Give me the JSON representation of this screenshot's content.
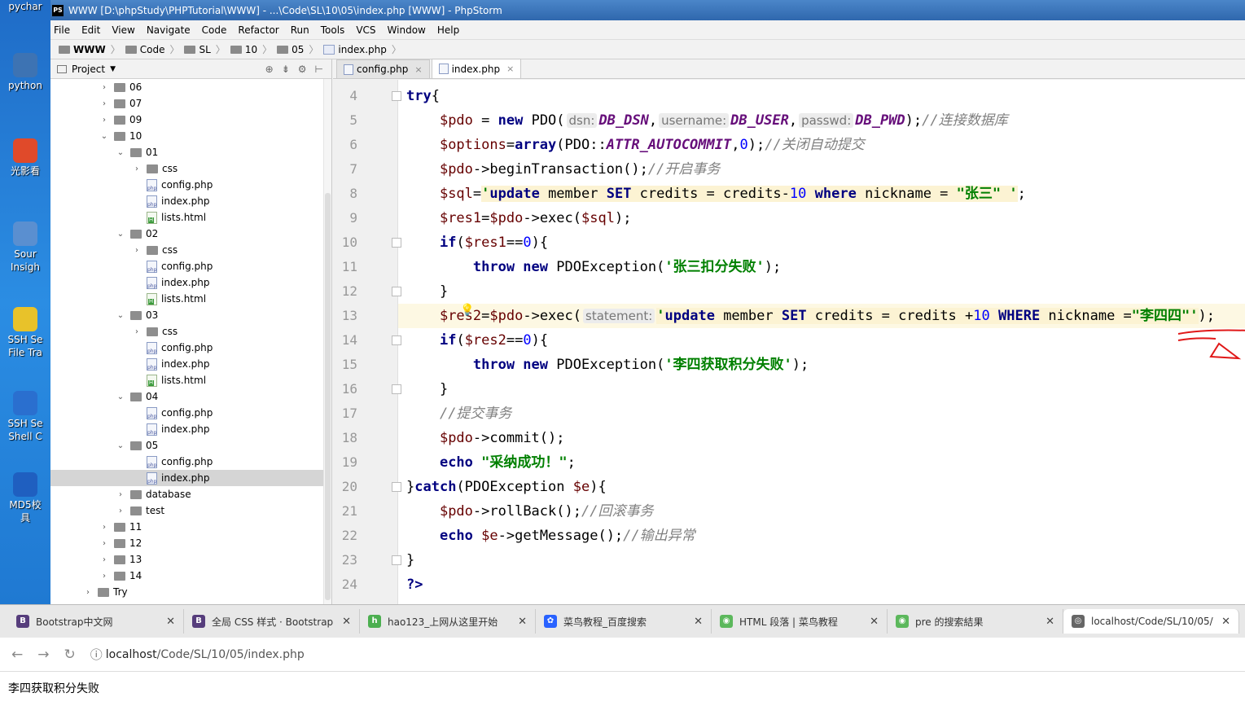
{
  "desktop": {
    "icons": [
      {
        "label": "pychar",
        "color": "#3a9b6b"
      },
      {
        "label": "python",
        "color": "#3d73b3"
      },
      {
        "label": "光影看",
        "color": "#e04a2a"
      },
      {
        "label": "Sour\nInsigh",
        "color": "#5a8fd0"
      },
      {
        "label": "SSH Se\nFile Tra",
        "color": "#e8c22a"
      },
      {
        "label": "SSH Se\nShell C",
        "color": "#2a6fcf"
      },
      {
        "label": "MD5校\n具",
        "color": "#1f5fc0"
      }
    ]
  },
  "ide": {
    "window_title": "WWW [D:\\phpStudy\\PHPTutorial\\WWW] - ...\\Code\\SL\\10\\05\\index.php [WWW] - PhpStorm",
    "app_icon": "PS",
    "menu": [
      "File",
      "Edit",
      "View",
      "Navigate",
      "Code",
      "Refactor",
      "Run",
      "Tools",
      "VCS",
      "Window",
      "Help"
    ],
    "breadcrumbs": [
      "WWW",
      "Code",
      "SL",
      "10",
      "05",
      "index.php"
    ],
    "project_panel_title": "Project",
    "tree": [
      {
        "label": "06",
        "type": "folder",
        "depth": 0,
        "arrow": "›"
      },
      {
        "label": "07",
        "type": "folder",
        "depth": 0,
        "arrow": "›"
      },
      {
        "label": "09",
        "type": "folder",
        "depth": 0,
        "arrow": "›"
      },
      {
        "label": "10",
        "type": "folder",
        "depth": 0,
        "arrow": "⌄"
      },
      {
        "label": "01",
        "type": "folder",
        "depth": 1,
        "arrow": "⌄"
      },
      {
        "label": "css",
        "type": "folder",
        "depth": 2,
        "arrow": "›"
      },
      {
        "label": "config.php",
        "type": "php",
        "depth": 2,
        "arrow": ""
      },
      {
        "label": "index.php",
        "type": "php",
        "depth": 2,
        "arrow": ""
      },
      {
        "label": "lists.html",
        "type": "html",
        "depth": 2,
        "arrow": ""
      },
      {
        "label": "02",
        "type": "folder",
        "depth": 1,
        "arrow": "⌄"
      },
      {
        "label": "css",
        "type": "folder",
        "depth": 2,
        "arrow": "›"
      },
      {
        "label": "config.php",
        "type": "php",
        "depth": 2,
        "arrow": ""
      },
      {
        "label": "index.php",
        "type": "php",
        "depth": 2,
        "arrow": ""
      },
      {
        "label": "lists.html",
        "type": "html",
        "depth": 2,
        "arrow": ""
      },
      {
        "label": "03",
        "type": "folder",
        "depth": 1,
        "arrow": "⌄"
      },
      {
        "label": "css",
        "type": "folder",
        "depth": 2,
        "arrow": "›"
      },
      {
        "label": "config.php",
        "type": "php",
        "depth": 2,
        "arrow": ""
      },
      {
        "label": "index.php",
        "type": "php",
        "depth": 2,
        "arrow": ""
      },
      {
        "label": "lists.html",
        "type": "html",
        "depth": 2,
        "arrow": ""
      },
      {
        "label": "04",
        "type": "folder",
        "depth": 1,
        "arrow": "⌄"
      },
      {
        "label": "config.php",
        "type": "php",
        "depth": 2,
        "arrow": ""
      },
      {
        "label": "index.php",
        "type": "php",
        "depth": 2,
        "arrow": ""
      },
      {
        "label": "05",
        "type": "folder",
        "depth": 1,
        "arrow": "⌄"
      },
      {
        "label": "config.php",
        "type": "php",
        "depth": 2,
        "arrow": ""
      },
      {
        "label": "index.php",
        "type": "php",
        "depth": 2,
        "arrow": "",
        "selected": true
      },
      {
        "label": "database",
        "type": "folder",
        "depth": 1,
        "arrow": "›"
      },
      {
        "label": "test",
        "type": "folder",
        "depth": 1,
        "arrow": "›"
      },
      {
        "label": "11",
        "type": "folder",
        "depth": 0,
        "arrow": "›"
      },
      {
        "label": "12",
        "type": "folder",
        "depth": 0,
        "arrow": "›"
      },
      {
        "label": "13",
        "type": "folder",
        "depth": 0,
        "arrow": "›"
      },
      {
        "label": "14",
        "type": "folder",
        "depth": 0,
        "arrow": "›"
      },
      {
        "label": "Try",
        "type": "folder",
        "depth": -1,
        "arrow": "›"
      }
    ],
    "editor_tabs": [
      {
        "label": "config.php",
        "active": false
      },
      {
        "label": "index.php",
        "active": true
      }
    ],
    "code_lines": [
      {
        "n": "4",
        "html": "<span class=\"kw\">try</span>{"
      },
      {
        "n": "5",
        "html": "    <span class=\"var\">$pdo</span> = <span class=\"kw\">new</span> PDO(<span class=\"hint\">dsn:</span><span class=\"cn\">DB_DSN</span>,<span class=\"hint\">username:</span><span class=\"cn\">DB_USER</span>,<span class=\"hint\">passwd:</span><span class=\"cn\">DB_PWD</span>);<span class=\"cm\">//连接数据库</span>"
      },
      {
        "n": "6",
        "html": "    <span class=\"var\">$options</span>=<span class=\"kw\">array</span>(PDO::<span class=\"cn\">ATTR_AUTOCOMMIT</span>,<span class=\"num\">0</span>);<span class=\"cm\">//关闭自动提交</span>"
      },
      {
        "n": "7",
        "html": "    <span class=\"var\">$pdo</span>-&gt;beginTransaction();<span class=\"cm\">//开启事务</span>"
      },
      {
        "n": "8",
        "html": "    <span class=\"var\">$sql</span>=<span class=\"sqlbg\"><span class=\"st\">'</span><span class=\"kw\">update</span> member <span class=\"kw\">SET</span> credits = credits-<span class=\"num\">10</span> <span class=\"kw\">where</span> nickname = <span class=\"st\">\"张三\"</span> <span class=\"st\">'</span></span>;"
      },
      {
        "n": "9",
        "html": "    <span class=\"var\">$res1</span>=<span class=\"var\">$pdo</span>-&gt;exec(<span class=\"var\">$sql</span>);"
      },
      {
        "n": "10",
        "html": "    <span class=\"kw\">if</span>(<span class=\"var\">$res1</span>==<span class=\"num\">0</span>){"
      },
      {
        "n": "11",
        "html": "        <span class=\"kw\">throw new</span> PDOException(<span class=\"st\">'张三扣分失败'</span>);"
      },
      {
        "n": "12",
        "html": "    }"
      },
      {
        "n": "13",
        "html": "    <span class=\"var\">$res2</span>=<span class=\"var\">$pdo</span>-&gt;exec(<span class=\"hint\">statement:</span><span class=\"sqlbg\"><span class=\"st\">'</span><span class=\"kw\">update</span> member <span class=\"kw\">SET</span> credits = credits +<span class=\"num\">10</span> <span class=\"kw\">WHERE</span> nickname =<span class=\"st\">\"李四四\"</span><span class=\"st\">'</span></span>);",
        "highlight": true
      },
      {
        "n": "14",
        "html": "    <span class=\"kw\">if</span>(<span class=\"var\">$res2</span>==<span class=\"num\">0</span>){"
      },
      {
        "n": "15",
        "html": "        <span class=\"kw\">throw new</span> PDOException(<span class=\"st\">'李四获取积分失败'</span>);"
      },
      {
        "n": "16",
        "html": "    }"
      },
      {
        "n": "17",
        "html": "    <span class=\"cm\">//提交事务</span>"
      },
      {
        "n": "18",
        "html": "    <span class=\"var\">$pdo</span>-&gt;commit();"
      },
      {
        "n": "19",
        "html": "    <span class=\"kw\">echo</span> <span class=\"st\">\"采纳成功！\"</span>;"
      },
      {
        "n": "20",
        "html": "}<span class=\"kw\">catch</span>(PDOException <span class=\"var\">$e</span>){"
      },
      {
        "n": "21",
        "html": "    <span class=\"var\">$pdo</span>-&gt;rollBack();<span class=\"cm\">//回滚事务</span>"
      },
      {
        "n": "22",
        "html": "    <span class=\"kw\">echo</span> <span class=\"var\">$e</span>-&gt;getMessage();<span class=\"cm\">//输出异常</span>"
      },
      {
        "n": "23",
        "html": "}"
      },
      {
        "n": "24",
        "html": "<span class=\"kw\">?&gt;</span>"
      }
    ]
  },
  "browser": {
    "tabs": [
      {
        "label": "Bootstrap中文网",
        "icon": "B",
        "color": "#563d7c"
      },
      {
        "label": "全局 CSS 样式 · Bootstrap v",
        "icon": "B",
        "color": "#563d7c"
      },
      {
        "label": "hao123_上网从这里开始",
        "icon": "h",
        "color": "#4caf50"
      },
      {
        "label": "菜鸟教程_百度搜索",
        "icon": "✿",
        "color": "#2962ff"
      },
      {
        "label": "HTML 段落 | 菜鸟教程",
        "icon": "◉",
        "color": "#5cb85c"
      },
      {
        "label": "pre 的搜索結果",
        "icon": "◉",
        "color": "#5cb85c"
      },
      {
        "label": "localhost/Code/SL/10/05/",
        "icon": "◎",
        "color": "#666666",
        "active": true
      }
    ],
    "url_host": "localhost",
    "url_path": "/Code/SL/10/05/index.php",
    "page_text": "李四获取积分失败"
  }
}
